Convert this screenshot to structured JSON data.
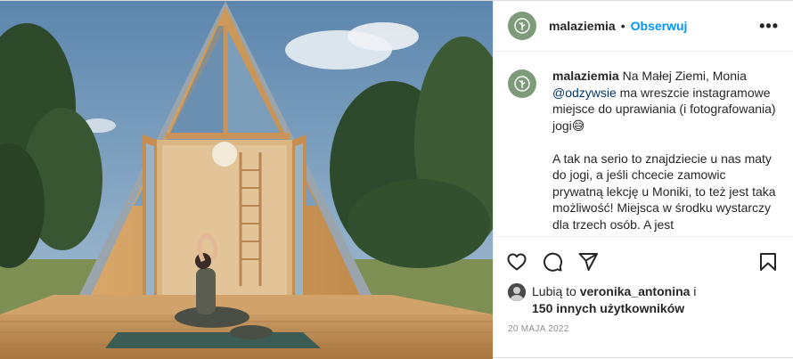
{
  "post": {
    "username": "malaziemia",
    "separator": "•",
    "follow_label": "Obserwuj",
    "more_label": "•••"
  },
  "caption": {
    "username": "malaziemia",
    "line1_pre": "Na Małej Ziemi, Monia ",
    "mention": "@odzywsie",
    "line1_post": " ma wreszcie instagramowe miejsce do uprawiania (i fotografowania) jogi😅",
    "paragraph2": "A tak na serio to znajdziecie u nas maty do jogi, a jeśli chcecie zamowic prywatną lekcję u Moniki, to też jest taka możliwość! Miejsca w środku wystarczy dla trzech osób. A jest"
  },
  "actions": {
    "like": "heart-icon",
    "comment": "comment-icon",
    "share": "share-icon",
    "save": "bookmark-icon"
  },
  "likes": {
    "prefix": "Lubią to ",
    "user": "veronika_antonina",
    "suffix": " i",
    "others": "150 innych użytkowników"
  },
  "date": "20 MAJA 2022",
  "colors": {
    "follow": "#0095f6",
    "avatar_bg": "#7d9b79",
    "text": "#262626",
    "muted": "#8e8e8e"
  }
}
